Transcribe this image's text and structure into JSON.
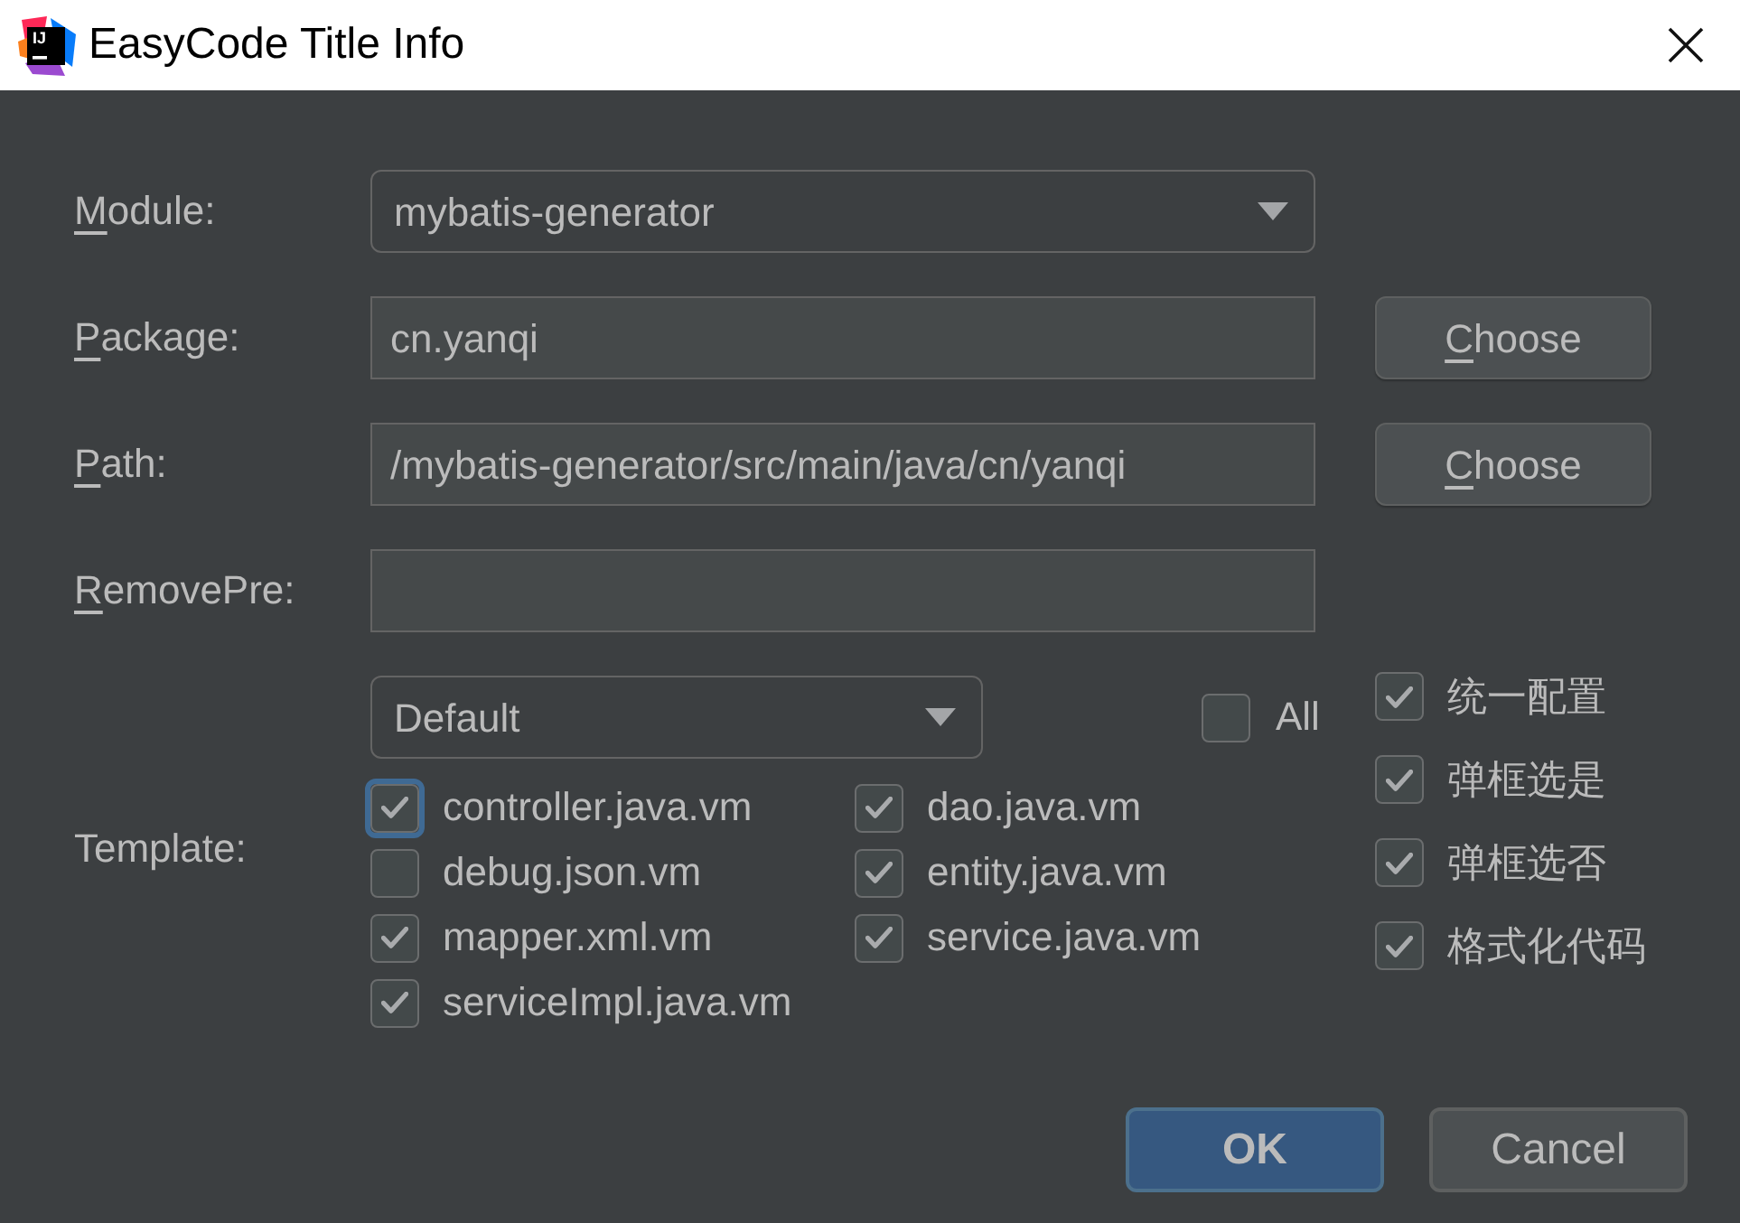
{
  "window": {
    "title": "EasyCode Title Info",
    "logo_text": "IJ"
  },
  "fields": [
    {
      "label": "Module:",
      "mnemonic": true,
      "kind": "dropdown",
      "value": "mybatis-generator"
    },
    {
      "label": "Package:",
      "mnemonic": true,
      "kind": "text",
      "value": "cn.yanqi",
      "button": {
        "label": "Choose",
        "mnemonic": true
      }
    },
    {
      "label": "Path:",
      "mnemonic": true,
      "kind": "text",
      "value": "/mybatis-generator/src/main/java/cn/yanqi",
      "button": {
        "label": "Choose",
        "mnemonic": true
      }
    },
    {
      "label": "RemovePre:",
      "mnemonic": true,
      "kind": "text"
    }
  ],
  "template": {
    "label": "Template:",
    "group": {
      "value": "Default"
    },
    "all": {
      "label": "All",
      "checked": false
    },
    "items": [
      {
        "label": "controller.java.vm",
        "checked": true,
        "focused": true
      },
      {
        "label": "dao.java.vm",
        "checked": true,
        "focused": false
      },
      {
        "label": "debug.json.vm",
        "checked": false,
        "focused": false
      },
      {
        "label": "entity.java.vm",
        "checked": true,
        "focused": false
      },
      {
        "label": "mapper.xml.vm",
        "checked": true,
        "focused": false
      },
      {
        "label": "service.java.vm",
        "checked": true,
        "focused": false
      },
      {
        "label": "serviceImpl.java.vm",
        "checked": true,
        "focused": false
      }
    ],
    "options": [
      {
        "label": "统一配置",
        "checked": true
      },
      {
        "label": "弹框选是",
        "checked": true
      },
      {
        "label": "弹框选否",
        "checked": true
      },
      {
        "label": "格式化代码",
        "checked": true
      }
    ]
  },
  "buttons": [
    {
      "label": "OK",
      "kind": "primary"
    },
    {
      "label": "Cancel",
      "kind": "secondary"
    }
  ]
}
